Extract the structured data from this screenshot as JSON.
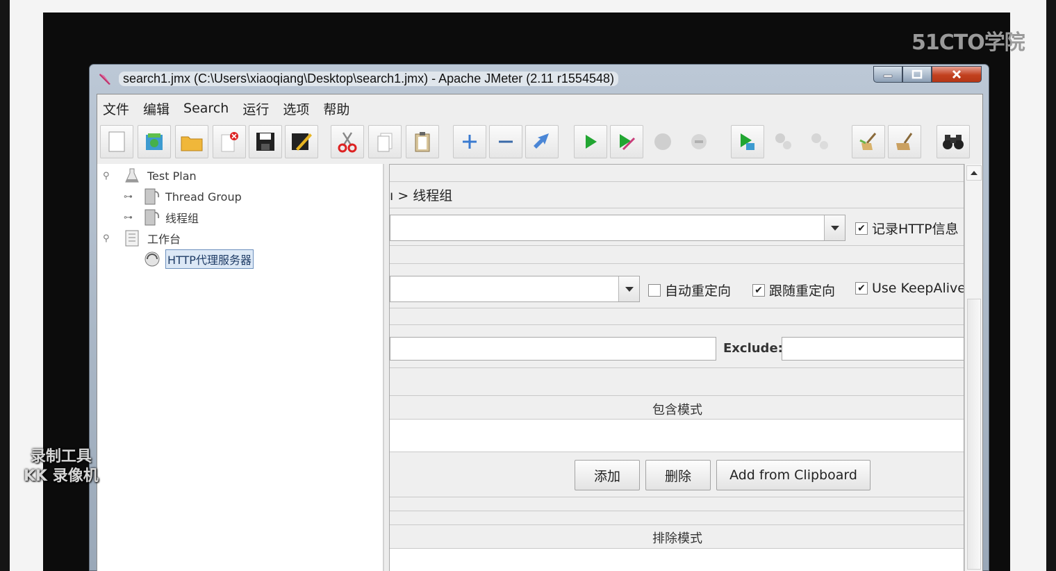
{
  "watermark": {
    "brand": "51CTO学院",
    "recorder_line1": "录制工具",
    "recorder_line2": "KK 录像机"
  },
  "window": {
    "title": "search1.jmx (C:\\Users\\xiaoqiang\\Desktop\\search1.jmx) - Apache JMeter (2.11 r1554548)"
  },
  "menu": {
    "items": [
      "文件",
      "编辑",
      "Search",
      "运行",
      "选项",
      "帮助"
    ]
  },
  "toolbar": {
    "icons": [
      "new-icon",
      "templates-icon",
      "open-icon",
      "close-plan-icon",
      "save-icon",
      "save-as-icon",
      "cut-icon",
      "copy-icon",
      "paste-icon",
      "expand-icon",
      "collapse-icon",
      "toggle-icon",
      "start-icon",
      "start-no-pauses-icon",
      "stop-icon",
      "shutdown-icon",
      "remote-start-icon",
      "remote-stop-icon",
      "remote-shutdown-icon",
      "clear-icon",
      "clear-all-icon",
      "search-icon"
    ]
  },
  "tree": {
    "items": [
      {
        "label": "Test Plan",
        "icon": "flask-icon",
        "expander": "⚲"
      },
      {
        "label": "Thread Group",
        "icon": "spool-icon",
        "expander": "⊶"
      },
      {
        "label": "线程组",
        "icon": "spool-icon",
        "expander": "⊶"
      },
      {
        "label": "工作台",
        "icon": "workbench-icon",
        "expander": "⚲"
      },
      {
        "label": "HTTP代理服务器",
        "icon": "proxy-icon",
        "expander": ""
      }
    ]
  },
  "right": {
    "breadcrumb": "ı > 线程组",
    "record_http_label": "记录HTTP信息",
    "auto_redirect_label": "自动重定向",
    "follow_redirect_label": "跟随重定向",
    "keepalive_label": "Use KeepAlive",
    "exclude_label": "Exclude:",
    "include_section": "包含模式",
    "exclude_section": "排除模式",
    "buttons": {
      "add": "添加",
      "delete": "删除",
      "add_clipboard": "Add from Clipboard"
    },
    "checks": {
      "record_http": true,
      "auto_redirect": false,
      "follow_redirect": true,
      "keepalive": true
    }
  }
}
